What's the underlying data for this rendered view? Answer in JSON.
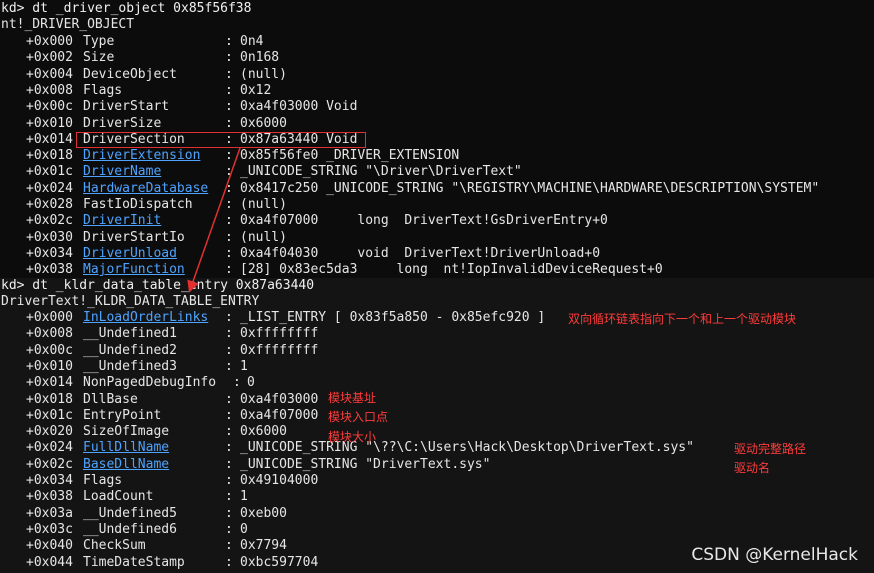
{
  "cmd1": "kd> dt _driver_object 0x85f56f38",
  "type1": "nt!_DRIVER_OBJECT",
  "rows1": [
    {
      "off": "+0x000",
      "name": "Type",
      "link": false,
      "val": "0n4"
    },
    {
      "off": "+0x002",
      "name": "Size",
      "link": false,
      "val": "0n168"
    },
    {
      "off": "+0x004",
      "name": "DeviceObject",
      "link": false,
      "val": "(null)"
    },
    {
      "off": "+0x008",
      "name": "Flags",
      "link": false,
      "val": "0x12"
    },
    {
      "off": "+0x00c",
      "name": "DriverStart",
      "link": false,
      "val": "0xa4f03000 Void"
    },
    {
      "off": "+0x010",
      "name": "DriverSize",
      "link": false,
      "val": "0x6000"
    },
    {
      "off": "+0x014",
      "name": "DriverSection",
      "link": false,
      "val": "0x87a63440 Void"
    },
    {
      "off": "+0x018",
      "name": "DriverExtension",
      "link": true,
      "val": "0x85f56fe0 _DRIVER_EXTENSION"
    },
    {
      "off": "+0x01c",
      "name": "DriverName",
      "link": true,
      "val": "_UNICODE_STRING \"\\Driver\\DriverText\""
    },
    {
      "off": "+0x024",
      "name": "HardwareDatabase",
      "link": true,
      "val": "0x8417c250 _UNICODE_STRING \"\\REGISTRY\\MACHINE\\HARDWARE\\DESCRIPTION\\SYSTEM\""
    },
    {
      "off": "+0x028",
      "name": "FastIoDispatch",
      "link": false,
      "val": "(null)"
    },
    {
      "off": "+0x02c",
      "name": "DriverInit",
      "link": true,
      "val": "0xa4f07000     long  DriverText!GsDriverEntry+0"
    },
    {
      "off": "+0x030",
      "name": "DriverStartIo",
      "link": false,
      "val": "(null)"
    },
    {
      "off": "+0x034",
      "name": "DriverUnload",
      "link": true,
      "val": "0xa4f04030     void  DriverText!DriverUnload+0"
    },
    {
      "off": "+0x038",
      "name": "MajorFunction",
      "link": true,
      "val": "[28] 0x83ec5da3     long  nt!IopInvalidDeviceRequest+0"
    }
  ],
  "cmd2": "kd> dt _kldr_data_table_entry 0x87a63440",
  "type2": "DriverText!_KLDR_DATA_TABLE_ENTRY",
  "rows2": [
    {
      "off": "+0x000",
      "name": "InLoadOrderLinks",
      "link": true,
      "val": "_LIST_ENTRY [ 0x83f5a850 - 0x85efc920 ]"
    },
    {
      "off": "+0x008",
      "name": "__Undefined1",
      "link": false,
      "val": "0xffffffff"
    },
    {
      "off": "+0x00c",
      "name": "__Undefined2",
      "link": false,
      "val": "0xffffffff"
    },
    {
      "off": "+0x010",
      "name": "__Undefined3",
      "link": false,
      "val": "1"
    },
    {
      "off": "+0x014",
      "name": "NonPagedDebugInfo",
      "link": false,
      "val": "0"
    },
    {
      "off": "+0x018",
      "name": "DllBase",
      "link": false,
      "val": "0xa4f03000"
    },
    {
      "off": "+0x01c",
      "name": "EntryPoint",
      "link": false,
      "val": "0xa4f07000"
    },
    {
      "off": "+0x020",
      "name": "SizeOfImage",
      "link": false,
      "val": "0x6000"
    },
    {
      "off": "+0x024",
      "name": "FullDllName",
      "link": true,
      "val": "_UNICODE_STRING \"\\??\\C:\\Users\\Hack\\Desktop\\DriverText.sys\""
    },
    {
      "off": "+0x02c",
      "name": "BaseDllName",
      "link": true,
      "val": "_UNICODE_STRING \"DriverText.sys\""
    },
    {
      "off": "+0x034",
      "name": "Flags",
      "link": false,
      "val": "0x49104000"
    },
    {
      "off": "+0x038",
      "name": "LoadCount",
      "link": false,
      "val": "1"
    },
    {
      "off": "+0x03a",
      "name": "__Undefined5",
      "link": false,
      "val": "0xeb00"
    },
    {
      "off": "+0x03c",
      "name": "__Undefined6",
      "link": false,
      "val": "0"
    },
    {
      "off": "+0x040",
      "name": "CheckSum",
      "link": false,
      "val": "0x7794"
    },
    {
      "off": "+0x044",
      "name": "TimeDateStamp",
      "link": false,
      "val": "0xbc597704"
    }
  ],
  "annotations": {
    "list_links": "双向循环链表指向下一个和上一个驱动模块",
    "dll_base": "模块基址",
    "entry_point": "模块入口点",
    "size_of_image": "模块大小",
    "full_name": "驱动完整路径",
    "base_name": "驱动名"
  },
  "watermark": "CSDN @KernelHack",
  "colors": {
    "link": "#4ea3ff",
    "annotation": "#ff3b3b",
    "highlight": "#e03030"
  }
}
